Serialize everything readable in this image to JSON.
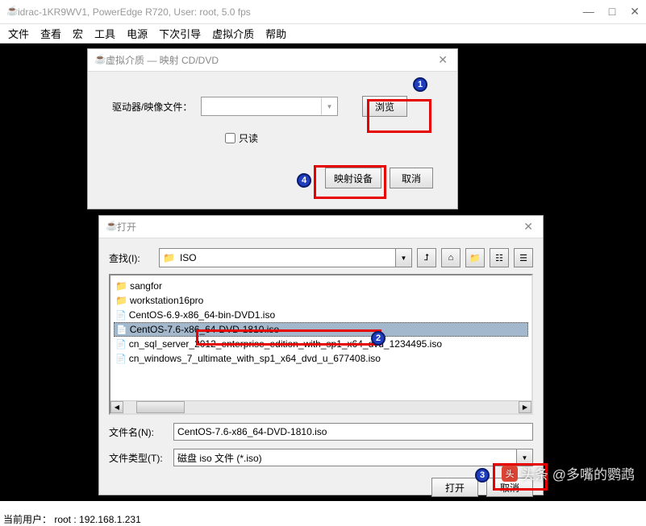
{
  "window": {
    "title": "idrac-1KR9WV1, PowerEdge R720, User: root, 5.0 fps"
  },
  "menu": [
    "文件",
    "查看",
    "宏",
    "工具",
    "电源",
    "下次引导",
    "虚拟介质",
    "帮助"
  ],
  "vm_dialog": {
    "title": "虚拟介质 — 映射 CD/DVD",
    "drive_label": "驱动器/映像文件：",
    "readonly_label": "只读",
    "browse": "浏览",
    "map_device": "映射设备",
    "cancel": "取消"
  },
  "open_dialog": {
    "title": "打开",
    "lookin_label": "查找(I):",
    "lookin_value": "ISO",
    "files": [
      {
        "name": "sangfor",
        "type": "folder"
      },
      {
        "name": "workstation16pro",
        "type": "folder"
      },
      {
        "name": "CentOS-6.9-x86_64-bin-DVD1.iso",
        "type": "file"
      },
      {
        "name": "CentOS-7.6-x86_64-DVD-1810.iso",
        "type": "file",
        "selected": true
      },
      {
        "name": "cn_sql_server_2012_enterprise_edition_with_sp1_x64_dvd_1234495.iso",
        "type": "file"
      },
      {
        "name": "cn_windows_7_ultimate_with_sp1_x64_dvd_u_677408.iso",
        "type": "file"
      }
    ],
    "filename_label": "文件名(N):",
    "filename_value": "CentOS-7.6-x86_64-DVD-1810.iso",
    "filetype_label": "文件类型(T):",
    "filetype_value": "磁盘 iso 文件 (*.iso)",
    "open_btn": "打开",
    "cancel_btn": "取消"
  },
  "annotations": {
    "n1": "1",
    "n2": "2",
    "n3": "3",
    "n4": "4"
  },
  "status": "当前用户： root : 192.168.1.231",
  "watermark": {
    "logo": "头",
    "text": "头条 @多嘴的鹦鹉"
  }
}
